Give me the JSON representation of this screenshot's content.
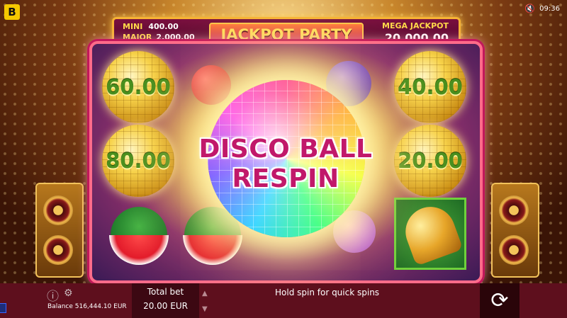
{
  "brand": {
    "logo_text": "B"
  },
  "status": {
    "time": "09:36",
    "mute_icon": "speaker-muted-icon"
  },
  "jackpots": {
    "mini_label": "MINI",
    "mini_value": "400.00",
    "major_label": "MAJOR",
    "major_value": "2,000.00",
    "title": "JACKPOT PARTY",
    "mega_label": "MEGA JACKPOT",
    "mega_value": "20,000.00"
  },
  "reels": {
    "ball_values": [
      "60.00",
      "80.00",
      "40.00",
      "20.00"
    ],
    "symbols": [
      "disco-ball",
      "watermelon",
      "cherry",
      "watermelon",
      "plum",
      "grapes",
      "bell"
    ]
  },
  "banner": {
    "line1": "DISCO BALL",
    "line2": "RESPIN"
  },
  "bottom": {
    "balance": "Balance 516,444.10 EUR",
    "bet_label": "Total bet",
    "bet_value": "20.00 EUR",
    "hint": "Hold spin for quick spins"
  },
  "colors": {
    "accent": "#c1186a",
    "gold": "#f7b234",
    "bar": "#5e0f1d"
  }
}
